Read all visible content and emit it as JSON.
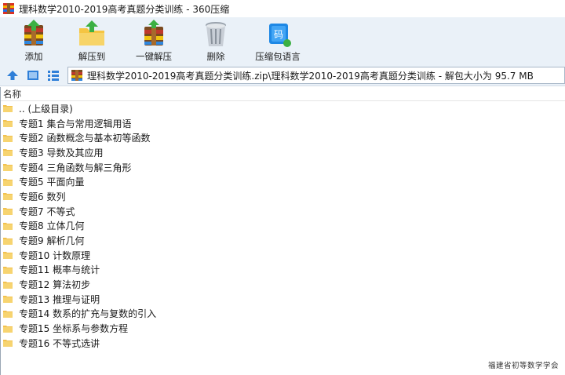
{
  "window": {
    "title": "理科数学2010-2019高考真题分类训练 - 360压缩"
  },
  "toolbar": {
    "add_label": "添加",
    "extract_to_label": "解压到",
    "one_click_extract_label": "一键解压",
    "delete_label": "删除",
    "encoding_label": "压缩包语言"
  },
  "address": {
    "path": "理科数学2010-2019高考真题分类训练.zip\\理科数学2010-2019高考真题分类训练 - 解包大小为 95.7 MB"
  },
  "list": {
    "column_name": "名称",
    "items": [
      ".. (上级目录)",
      "专题1  集合与常用逻辑用语",
      "专题2  函数概念与基本初等函数",
      "专题3 导数及其应用",
      "专题4  三角函数与解三角形",
      "专题5  平面向量",
      "专题6  数列",
      "专题7 不等式",
      "专题8  立体几何",
      "专题9  解析几何",
      "专题10  计数原理",
      "专题11 概率与统计",
      "专题12  算法初步",
      "专题13  推理与证明",
      "专题14 数系的扩充与复数的引入",
      "专题15  坐标系与参数方程",
      "专题16 不等式选讲"
    ]
  },
  "watermark": "福建省初等数学学会",
  "colors": {
    "toolbar_bg": "#eaf1f8",
    "folder_yellow": "#f2c14e",
    "nav_blue": "#2f7fd8"
  }
}
